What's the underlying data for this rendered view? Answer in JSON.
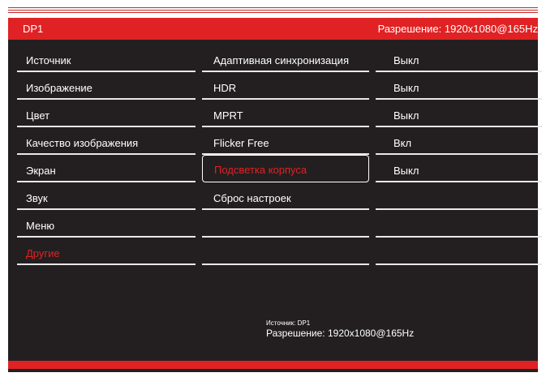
{
  "header": {
    "input_name": "DP1",
    "resolution": "Разрешение: 1920x1080@165Hz"
  },
  "menu": {
    "items": [
      {
        "label": "Источник"
      },
      {
        "label": "Изображение"
      },
      {
        "label": "Цвет"
      },
      {
        "label": "Качество изображения"
      },
      {
        "label": "Экран"
      },
      {
        "label": "Звук"
      },
      {
        "label": "Меню"
      },
      {
        "label": "Другие"
      }
    ],
    "selected": "Другие"
  },
  "submenu": {
    "items": [
      {
        "label": "Адаптивная синхронизация"
      },
      {
        "label": "HDR"
      },
      {
        "label": "MPRT"
      },
      {
        "label": "Flicker Free"
      },
      {
        "label": "Подсветка корпуса"
      },
      {
        "label": "Сброс настроек"
      },
      {
        "label": ""
      },
      {
        "label": ""
      }
    ],
    "focused": "Подсветка корпуса"
  },
  "values": {
    "items": [
      {
        "label": "Выкл"
      },
      {
        "label": "Выкл"
      },
      {
        "label": "Выкл"
      },
      {
        "label": "Вкл"
      },
      {
        "label": "Выкл"
      },
      {
        "label": ""
      },
      {
        "label": ""
      },
      {
        "label": ""
      }
    ]
  },
  "footer": {
    "source": "Источник: DP1",
    "resolution": "Разрешение: 1920x1080@165Hz"
  },
  "colors": {
    "accent": "#e02224",
    "background": "#231f20",
    "text": "#ffffff"
  }
}
